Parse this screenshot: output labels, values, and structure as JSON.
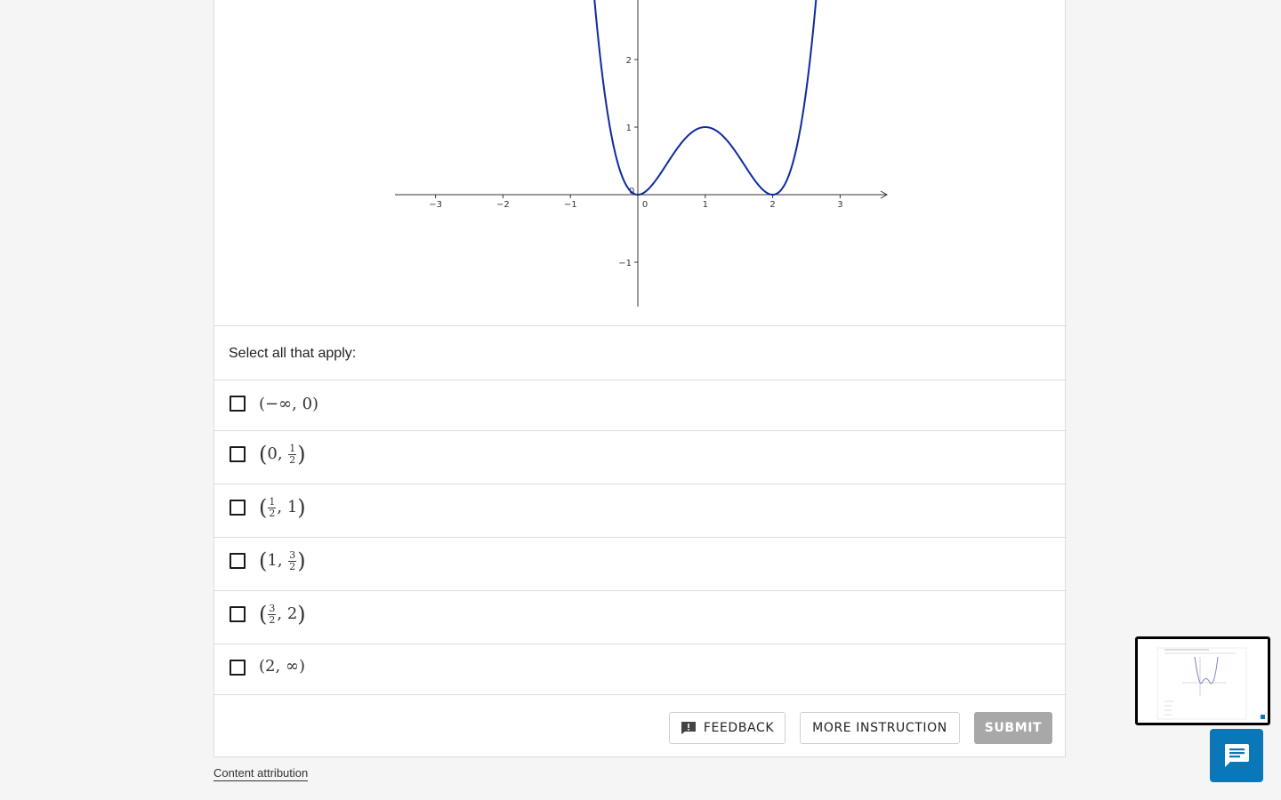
{
  "graph": {
    "x_ticks": [
      "−3",
      "−2",
      "−1",
      "0",
      "1",
      "2",
      "3"
    ],
    "y_ticks": [
      "2",
      "1",
      "−1"
    ],
    "origin_label": "0",
    "curve_color": "#0d2b9c"
  },
  "question": {
    "prompt": "Select all that apply:",
    "options": [
      {
        "open": "(",
        "parts": [
          "−∞",
          "0"
        ],
        "close": ")"
      },
      {
        "open": "(",
        "parts": [
          "0",
          "1/2"
        ],
        "close": ")"
      },
      {
        "open": "(",
        "parts": [
          "1/2",
          "1"
        ],
        "close": ")"
      },
      {
        "open": "(",
        "parts": [
          "1",
          "3/2"
        ],
        "close": ")"
      },
      {
        "open": "(",
        "parts": [
          "3/2",
          "2"
        ],
        "close": ")"
      },
      {
        "open": "(",
        "parts": [
          "2",
          "∞"
        ],
        "close": ")"
      }
    ]
  },
  "buttons": {
    "feedback": "FEEDBACK",
    "more_instruction": "MORE INSTRUCTION",
    "submit": "SUBMIT"
  },
  "footer": {
    "attribution": "Content attribution"
  },
  "icons": {
    "feedback": "feedback-icon",
    "chat": "chat-icon"
  },
  "colors": {
    "submit_bg": "#a8a8a8",
    "chat_bg": "#0a78b8"
  }
}
